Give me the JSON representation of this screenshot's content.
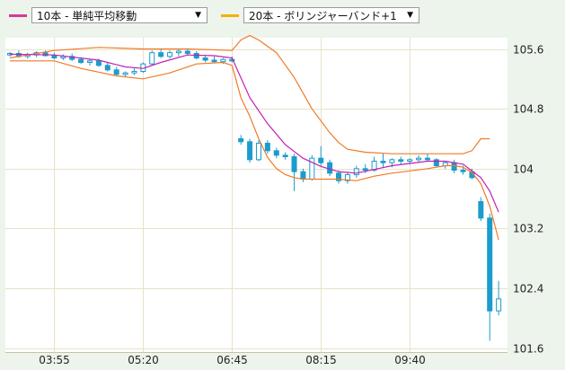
{
  "toolbar": {
    "indicator1": {
      "label": "10本 - 単純平均移動",
      "color": "#d63a9a"
    },
    "indicator2": {
      "label": "20本 - ボリンジャーバンド+1",
      "color": "#f0b400"
    }
  },
  "icons": {
    "dropdown": "caret-down-icon"
  },
  "colors": {
    "candle": "#1b9ccc",
    "ma_line": "#c21fb4",
    "band_line": "#f07a28",
    "grid": "#e9e2c8",
    "plot_bg": "#ffffff"
  },
  "chart_data": {
    "type": "candlestick",
    "y_ticks": [
      "105.6",
      "104.8",
      "104",
      "103.2",
      "102.4",
      "101.6"
    ],
    "y_tick_values": [
      105.6,
      104.8,
      104.0,
      103.2,
      102.4,
      101.6
    ],
    "ylim": [
      101.55,
      105.75
    ],
    "x_ticks": [
      "03:55",
      "05:20",
      "06:45",
      "08:15",
      "09:40"
    ],
    "x_tick_positions": [
      5.5,
      15.5,
      25.5,
      35.5,
      45.5
    ],
    "xlim": [
      0,
      56.5
    ],
    "grid": true,
    "candles": [
      [
        105.52,
        105.56,
        105.5,
        105.54
      ],
      [
        105.54,
        105.58,
        105.48,
        105.5
      ],
      [
        105.5,
        105.55,
        105.47,
        105.52
      ],
      [
        105.52,
        105.57,
        105.49,
        105.55
      ],
      [
        105.55,
        105.58,
        105.5,
        105.51
      ],
      [
        105.51,
        105.55,
        105.46,
        105.48
      ],
      [
        105.48,
        105.53,
        105.45,
        105.5
      ],
      [
        105.5,
        105.54,
        105.44,
        105.46
      ],
      [
        105.46,
        105.49,
        105.4,
        105.42
      ],
      [
        105.42,
        105.46,
        105.38,
        105.44
      ],
      [
        105.44,
        105.47,
        105.36,
        105.38
      ],
      [
        105.38,
        105.42,
        105.3,
        105.32
      ],
      [
        105.32,
        105.36,
        105.24,
        105.26
      ],
      [
        105.26,
        105.3,
        105.22,
        105.28
      ],
      [
        105.28,
        105.34,
        105.25,
        105.3
      ],
      [
        105.3,
        105.42,
        105.28,
        105.4
      ],
      [
        105.4,
        105.58,
        105.38,
        105.55
      ],
      [
        105.55,
        105.6,
        105.48,
        105.5
      ],
      [
        105.5,
        105.58,
        105.47,
        105.55
      ],
      [
        105.55,
        105.6,
        105.5,
        105.57
      ],
      [
        105.57,
        105.61,
        105.52,
        105.54
      ],
      [
        105.54,
        105.57,
        105.46,
        105.48
      ],
      [
        105.48,
        105.52,
        105.42,
        105.45
      ],
      [
        105.45,
        105.5,
        105.41,
        105.43
      ],
      [
        105.43,
        105.48,
        105.4,
        105.46
      ],
      [
        105.46,
        105.5,
        105.42,
        105.44
      ],
      [
        104.4,
        104.45,
        104.32,
        104.36
      ],
      [
        104.36,
        104.4,
        104.08,
        104.12
      ],
      [
        104.12,
        104.38,
        104.1,
        104.34
      ],
      [
        104.34,
        104.38,
        104.2,
        104.24
      ],
      [
        104.24,
        104.28,
        104.14,
        104.18
      ],
      [
        104.18,
        104.22,
        104.12,
        104.16
      ],
      [
        104.16,
        104.2,
        103.7,
        103.96
      ],
      [
        103.96,
        104.0,
        103.82,
        103.86
      ],
      [
        103.86,
        104.18,
        103.84,
        104.14
      ],
      [
        104.14,
        104.3,
        104.04,
        104.08
      ],
      [
        104.08,
        104.12,
        103.9,
        103.94
      ],
      [
        103.94,
        103.98,
        103.8,
        103.84
      ],
      [
        103.84,
        103.96,
        103.8,
        103.92
      ],
      [
        103.92,
        104.04,
        103.88,
        104.0
      ],
      [
        104.0,
        104.06,
        103.94,
        103.98
      ],
      [
        103.98,
        104.16,
        103.96,
        104.1
      ],
      [
        104.1,
        104.2,
        104.02,
        104.08
      ],
      [
        104.08,
        104.14,
        104.02,
        104.12
      ],
      [
        104.12,
        104.16,
        104.06,
        104.1
      ],
      [
        104.1,
        104.14,
        104.06,
        104.12
      ],
      [
        104.12,
        104.18,
        104.08,
        104.14
      ],
      [
        104.14,
        104.2,
        104.1,
        104.12
      ],
      [
        104.12,
        104.14,
        104.02,
        104.04
      ],
      [
        104.04,
        104.1,
        104.0,
        104.08
      ],
      [
        104.08,
        104.12,
        103.94,
        103.98
      ],
      [
        103.98,
        104.04,
        103.92,
        103.96
      ],
      [
        103.96,
        104.0,
        103.86,
        103.88
      ],
      [
        103.56,
        103.62,
        103.3,
        103.34
      ],
      [
        103.34,
        103.4,
        101.7,
        102.1
      ],
      [
        102.1,
        102.5,
        102.04,
        102.26
      ]
    ],
    "sma10": [
      [
        0,
        105.53
      ],
      [
        5,
        105.52
      ],
      [
        10,
        105.45
      ],
      [
        13,
        105.36
      ],
      [
        15,
        105.34
      ],
      [
        17,
        105.42
      ],
      [
        20,
        105.52
      ],
      [
        23,
        105.51
      ],
      [
        25,
        105.48
      ],
      [
        27,
        104.95
      ],
      [
        29,
        104.6
      ],
      [
        31,
        104.32
      ],
      [
        33,
        104.14
      ],
      [
        35,
        104.03
      ],
      [
        37,
        103.96
      ],
      [
        39,
        103.94
      ],
      [
        41,
        103.99
      ],
      [
        43,
        104.04
      ],
      [
        45,
        104.07
      ],
      [
        47,
        104.1
      ],
      [
        49,
        104.1
      ],
      [
        51,
        104.06
      ],
      [
        53,
        103.88
      ],
      [
        54,
        103.7
      ],
      [
        55,
        103.42
      ]
    ],
    "band_upper": [
      [
        0,
        105.48
      ],
      [
        5,
        105.58
      ],
      [
        10,
        105.62
      ],
      [
        15,
        105.6
      ],
      [
        20,
        105.6
      ],
      [
        25,
        105.58
      ],
      [
        26,
        105.72
      ],
      [
        27,
        105.78
      ],
      [
        28,
        105.72
      ],
      [
        30,
        105.55
      ],
      [
        32,
        105.22
      ],
      [
        34,
        104.8
      ],
      [
        36,
        104.48
      ],
      [
        37,
        104.35
      ],
      [
        38,
        104.26
      ],
      [
        40,
        104.22
      ],
      [
        43,
        104.2
      ],
      [
        46,
        104.2
      ],
      [
        49,
        104.2
      ],
      [
        51,
        104.2
      ],
      [
        52,
        104.24
      ],
      [
        53,
        104.4
      ],
      [
        54,
        104.4
      ]
    ],
    "band_lower": [
      [
        0,
        105.44
      ],
      [
        5,
        105.44
      ],
      [
        8,
        105.34
      ],
      [
        12,
        105.24
      ],
      [
        15,
        105.2
      ],
      [
        18,
        105.28
      ],
      [
        21,
        105.4
      ],
      [
        24,
        105.42
      ],
      [
        25,
        105.38
      ],
      [
        26,
        104.95
      ],
      [
        27,
        104.7
      ],
      [
        28,
        104.4
      ],
      [
        29,
        104.15
      ],
      [
        30,
        104.0
      ],
      [
        31,
        103.92
      ],
      [
        32,
        103.88
      ],
      [
        33,
        103.86
      ],
      [
        35,
        103.86
      ],
      [
        37,
        103.86
      ],
      [
        39,
        103.84
      ],
      [
        41,
        103.9
      ],
      [
        43,
        103.94
      ],
      [
        45,
        103.97
      ],
      [
        47,
        104.0
      ],
      [
        49,
        104.04
      ],
      [
        50,
        104.04
      ],
      [
        51,
        104.02
      ],
      [
        52,
        103.95
      ],
      [
        53,
        103.8
      ],
      [
        54,
        103.5
      ],
      [
        55,
        103.05
      ]
    ]
  }
}
